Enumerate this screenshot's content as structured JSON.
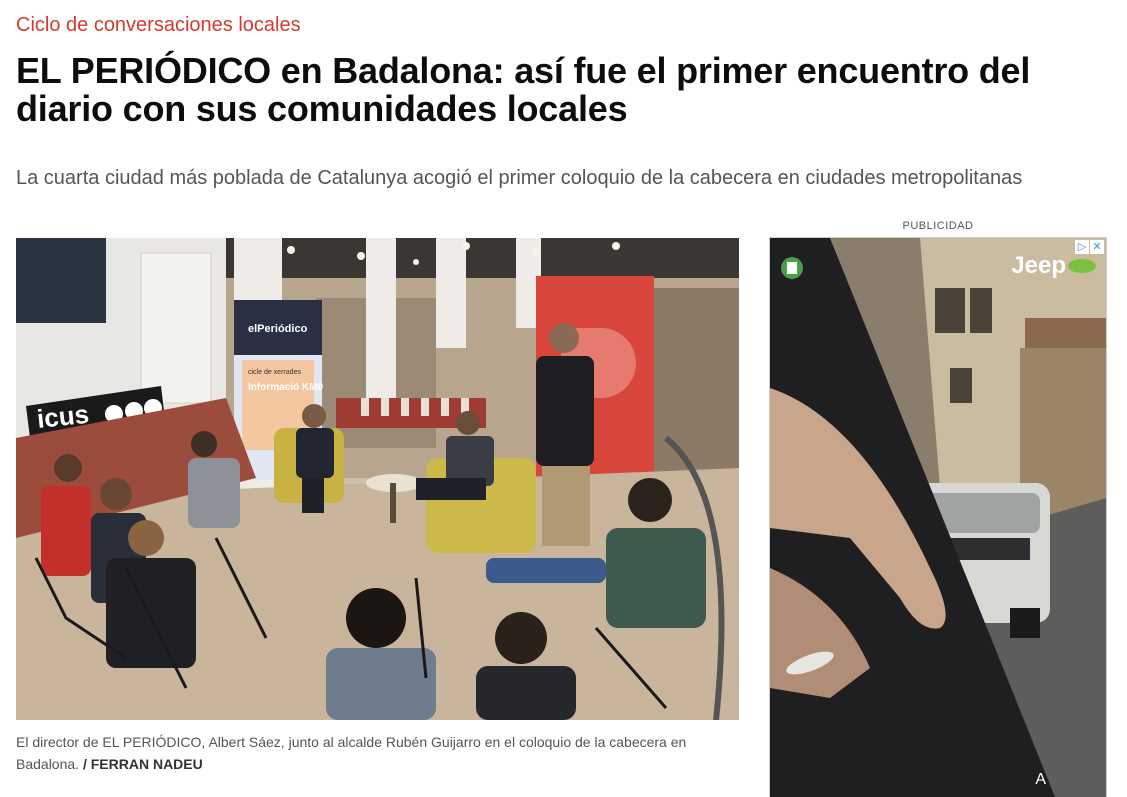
{
  "article": {
    "kicker": "Ciclo de conversaciones locales",
    "headline": "EL PERIÓDICO en Badalona: así fue el primer encuentro del diario con sus comunidades locales",
    "subtitle": "La cuarta ciudad más poblada de Catalunya acogió el primer coloquio de la cabecera en ciudades metropolitanas",
    "photo": {
      "caption": "El director de EL PERIÓDICO, Albert Sáez, junto al alcalde Rubén Guijarro en el coloquio de la cabecera en Badalona.",
      "credit": "/ FERRAN NADEU",
      "banner_brand": "elPeriódico",
      "banner_text": "cicle de xerrades",
      "banner_title": "Informació KM0",
      "store_sign": "icus"
    }
  },
  "ad": {
    "label": "PUBLICIDAD",
    "brand": "Jeep",
    "tail_text": "A",
    "adchoices_icon": "▷",
    "close_icon": "✕"
  }
}
